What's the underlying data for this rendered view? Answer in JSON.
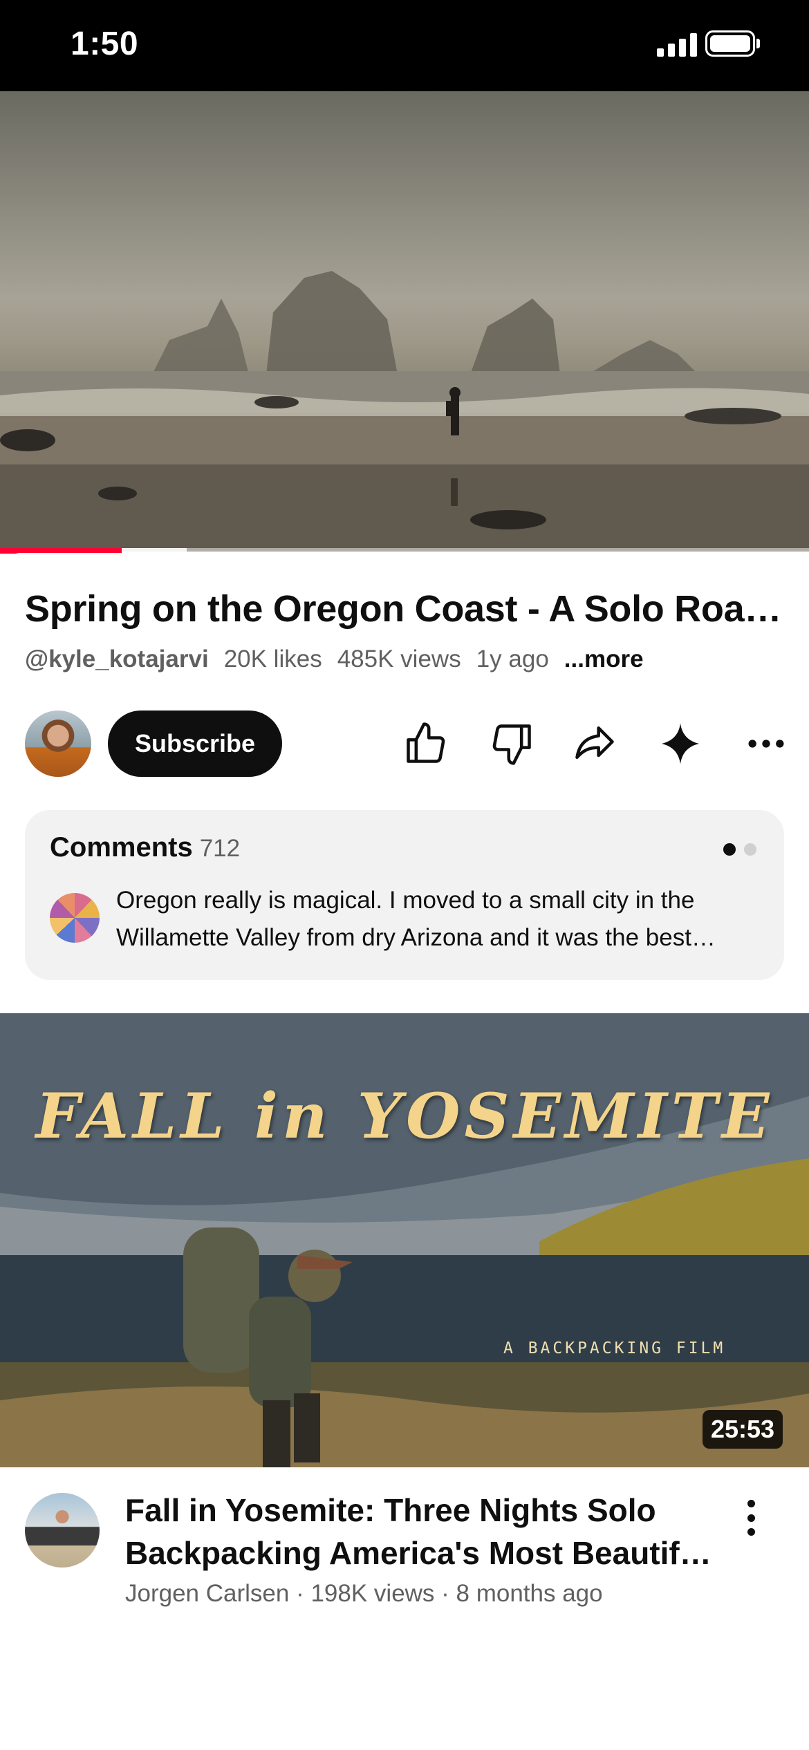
{
  "status_bar": {
    "time": "1:50"
  },
  "player": {
    "progress_fraction": 0.15
  },
  "video": {
    "title": "Spring on the Oregon Coast - A Solo Road Trip",
    "channel_handle": "@kyle_kotajarvi",
    "likes": "20K likes",
    "views": "485K views",
    "age": "1y ago",
    "more_label": "...more"
  },
  "actions": {
    "subscribe_label": "Subscribe",
    "icons": [
      "thumbs-up-icon",
      "thumbs-down-icon",
      "share-icon",
      "sparkle-icon",
      "more-horizontal-icon"
    ]
  },
  "comments": {
    "title": "Comments",
    "count": "712",
    "top_comment": "Oregon really is magical. I moved to a small city in the Willamette Valley from dry Arizona and it was the best decision I ever made."
  },
  "next_video": {
    "thumbnail_title": "FALL in YOSEMITE",
    "thumbnail_subtitle": "A BACKPACKING FILM",
    "duration": "25:53",
    "title": "Fall in Yosemite: Three Nights Solo Backpacking America's Most Beautiful National Park",
    "meta": "Jorgen Carlsen · 198K views · 8 months ago"
  },
  "colors": {
    "accent": "#ff0033",
    "text": "#0f0f0f",
    "secondary_text": "#606060"
  }
}
